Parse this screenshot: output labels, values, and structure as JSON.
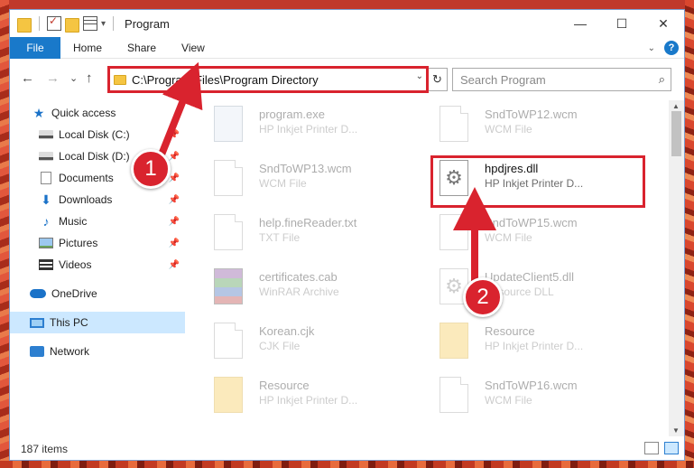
{
  "window": {
    "title": "Program",
    "controls": {
      "minimize": "—",
      "maximize": "☐",
      "close": "✕"
    }
  },
  "ribbon": {
    "tabs": [
      "File",
      "Home",
      "Share",
      "View"
    ],
    "help": "?"
  },
  "nav": {
    "back": "←",
    "forward": "→",
    "recent": "⌄",
    "up": "↑",
    "address": "C:\\Program Files\\Program Directory",
    "refresh": "↻",
    "search_placeholder": "Search Program",
    "search_icon": "⌕"
  },
  "sidebar": {
    "items": [
      {
        "label": "Quick access",
        "icon": "star-icon",
        "pinned": false
      },
      {
        "label": "Local Disk (C:)",
        "icon": "drive-icon",
        "pinned": true
      },
      {
        "label": "Local Disk (D:)",
        "icon": "drive-icon",
        "pinned": true
      },
      {
        "label": "Documents",
        "icon": "documents-icon",
        "pinned": true
      },
      {
        "label": "Downloads",
        "icon": "download-icon",
        "pinned": true
      },
      {
        "label": "Music",
        "icon": "music-icon",
        "pinned": true
      },
      {
        "label": "Pictures",
        "icon": "pictures-icon",
        "pinned": true
      },
      {
        "label": "Videos",
        "icon": "videos-icon",
        "pinned": true
      },
      {
        "label": "OneDrive",
        "icon": "cloud-icon",
        "pinned": false
      },
      {
        "label": "This PC",
        "icon": "computer-icon",
        "pinned": false,
        "selected": true
      },
      {
        "label": "Network",
        "icon": "network-icon",
        "pinned": false
      }
    ]
  },
  "files": [
    {
      "name": "program.exe",
      "type": "HP Inkjet Printer D...",
      "icon": "exe-icon"
    },
    {
      "name": "SndToWP12.wcm",
      "type": "WCM File",
      "icon": "document-icon"
    },
    {
      "name": "SndToWP13.wcm",
      "type": "WCM File",
      "icon": "document-icon"
    },
    {
      "name": "hpdjres.dll",
      "type": "HP Inkjet Printer D...",
      "icon": "gear-file-icon",
      "highlighted": true
    },
    {
      "name": "help.fineReader.txt",
      "type": "TXT File",
      "icon": "document-icon"
    },
    {
      "name": "SndToWP15.wcm",
      "type": "WCM File",
      "icon": "document-icon"
    },
    {
      "name": "certificates.cab",
      "type": "WinRAR Archive",
      "icon": "archive-icon"
    },
    {
      "name": "UpdateClient5.dll",
      "type": "Resource DLL",
      "icon": "gear-file-icon"
    },
    {
      "name": "Korean.cjk",
      "type": "CJK File",
      "icon": "document-icon"
    },
    {
      "name": "Resource",
      "type": "HP Inkjet Printer D...",
      "icon": "folder-icon"
    },
    {
      "name": "Resource",
      "type": "HP Inkjet Printer D...",
      "icon": "folder-icon"
    },
    {
      "name": "SndToWP16.wcm",
      "type": "WCM File",
      "icon": "document-icon"
    }
  ],
  "annotations": {
    "step1": "1",
    "step2": "2"
  },
  "status": {
    "count": "187 items"
  }
}
